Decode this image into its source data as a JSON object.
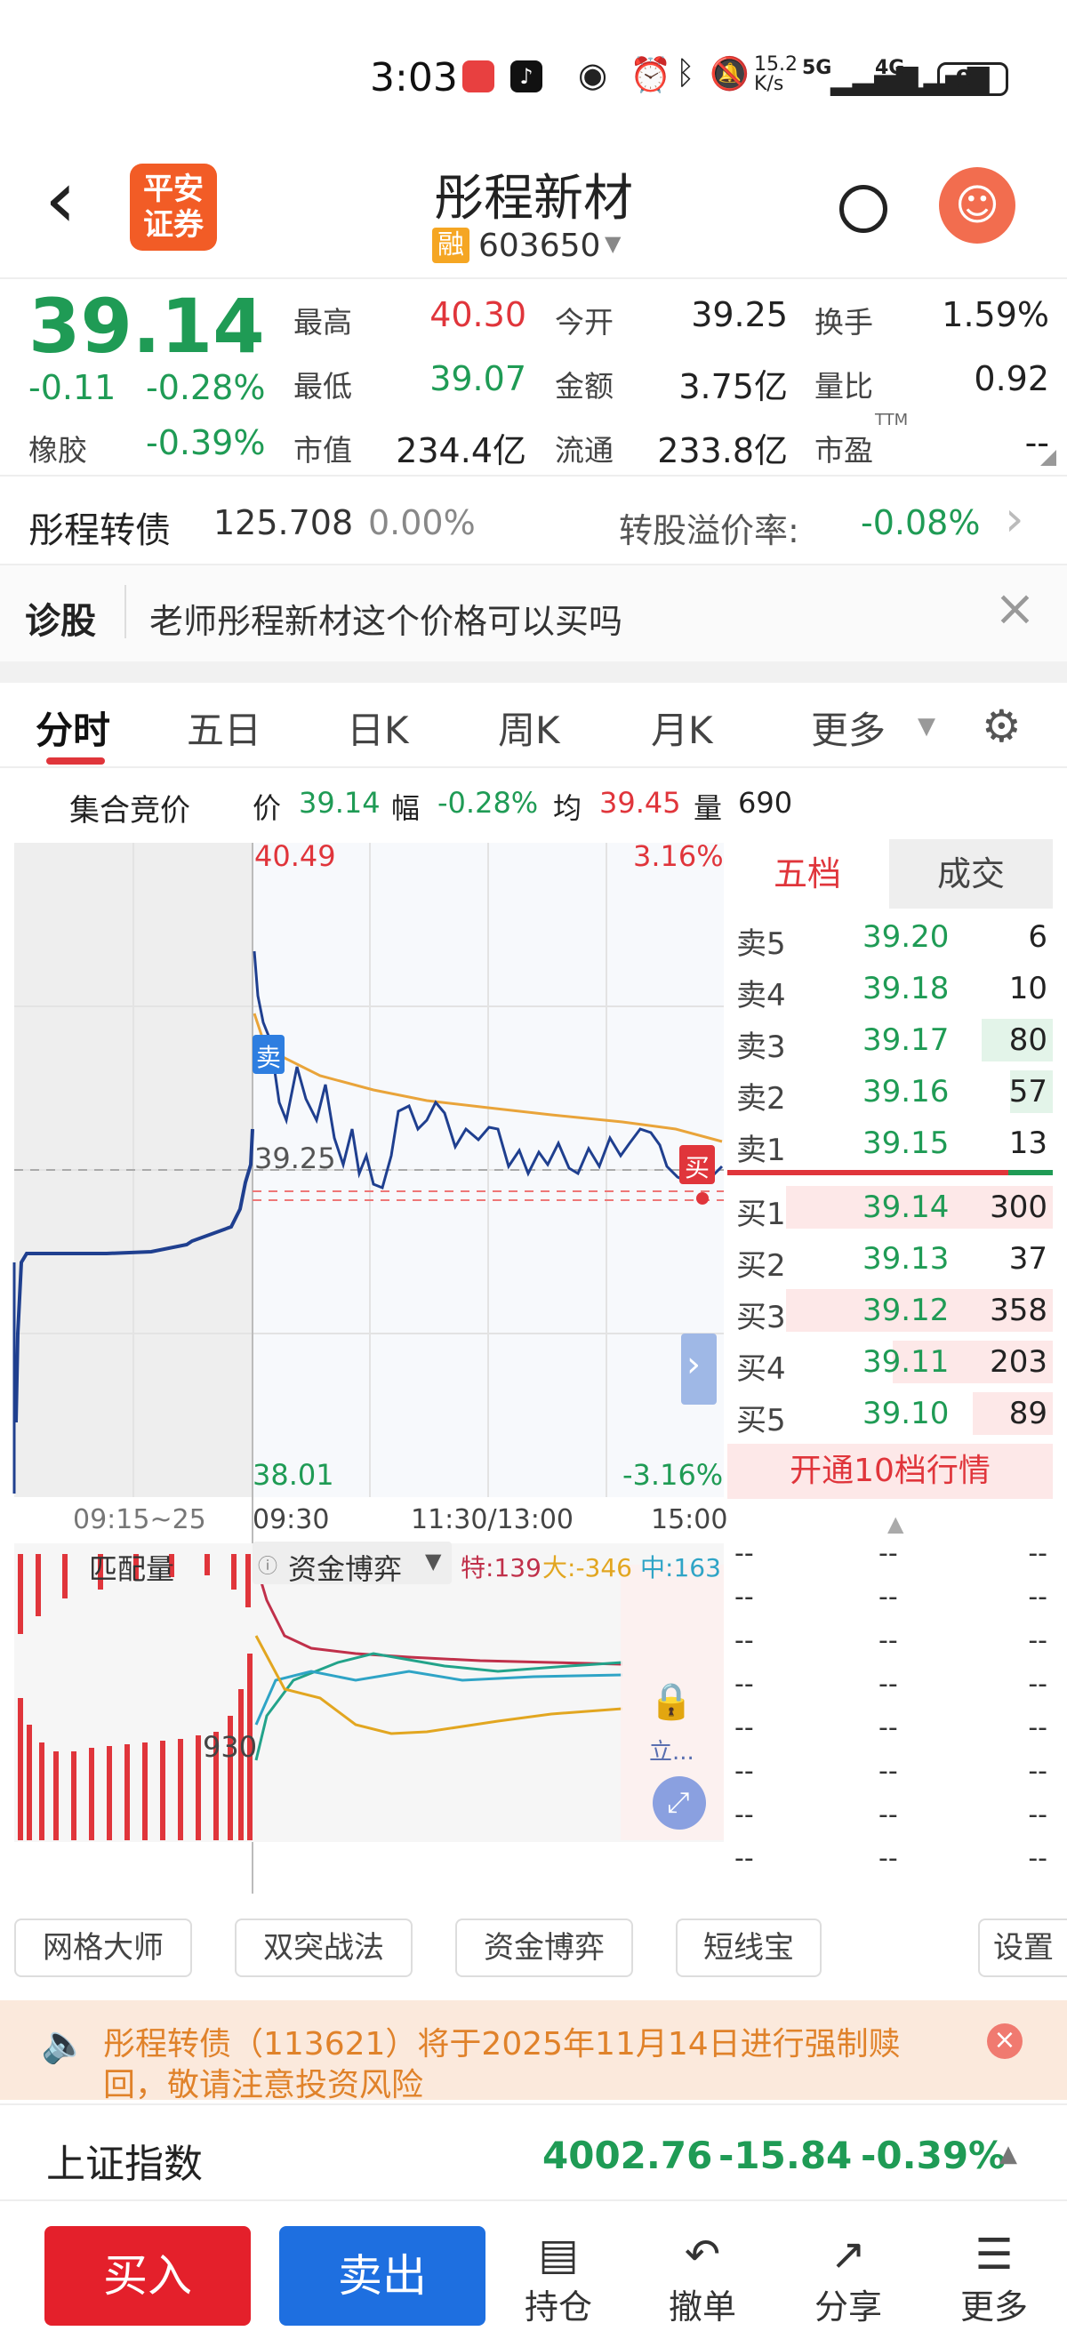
{
  "status": {
    "time": "3:03",
    "net_speed_top": "15.2",
    "net_speed_bottom": "K/s",
    "sig1": "5G",
    "sig2": "4G",
    "battery": "91"
  },
  "header": {
    "back": "‹",
    "broker_logo_line1": "平安",
    "broker_logo_line2": "证券",
    "title": "彤程新材",
    "margin_badge": "融",
    "code": "603650"
  },
  "quote": {
    "price": "39.14",
    "change": "-0.11",
    "change_pct": "-0.28%",
    "sector_label": "橡胶",
    "sector_pct": "-0.39%",
    "high_label": "最高",
    "high": "40.30",
    "low_label": "最低",
    "low": "39.07",
    "mcap_label": "市值",
    "mcap": "234.4亿",
    "open_label": "今开",
    "open": "39.25",
    "amount_label": "金额",
    "amount": "3.75亿",
    "float_label": "流通",
    "float": "233.8亿",
    "turnover_label": "换手",
    "turnover": "1.59%",
    "volratio_label": "量比",
    "volratio": "0.92",
    "pe_label": "市盈",
    "pe_sup": "TTM",
    "pe": "--"
  },
  "convertible": {
    "name": "彤程转债",
    "price": "125.708",
    "pct": "0.00%",
    "premium_label": "转股溢价率:",
    "premium": "-0.08%"
  },
  "diagnose": {
    "label": "诊股",
    "text": "老师彤程新材这个价格可以买吗"
  },
  "tabs": [
    "分时",
    "五日",
    "日K",
    "周K",
    "月K",
    "更多"
  ],
  "chart_info": {
    "auction": "集合竞价",
    "price_label": "价",
    "price": "39.14",
    "amp_label": "幅",
    "amp": "-0.28%",
    "avg_label": "均",
    "avg": "39.45",
    "vol_label": "量",
    "vol": "690"
  },
  "chart_labels": {
    "top_left": "40.49",
    "top_right": "3.16%",
    "bottom_left": "38.01",
    "bottom_right": "-3.16%",
    "mid": "39.25",
    "sell_tag": "卖",
    "buy_tag": "买"
  },
  "time_axis": [
    "09:15~25",
    "09:30",
    "11:30/13:00",
    "15:00"
  ],
  "sub_chart": {
    "tab1": "匹配量",
    "tab2": "资金博弈",
    "te_label": "特:",
    "te": "139",
    "da_label": "大:",
    "da": "-346",
    "zhong_label": "中:",
    "zhong": "163",
    "val": "930",
    "lock_text": "立..."
  },
  "book": {
    "tab_five": "五档",
    "tab_deal": "成交",
    "asks": [
      {
        "l": "卖5",
        "p": "39.20",
        "v": "6"
      },
      {
        "l": "卖4",
        "p": "39.18",
        "v": "10"
      },
      {
        "l": "卖3",
        "p": "39.17",
        "v": "80"
      },
      {
        "l": "卖2",
        "p": "39.16",
        "v": "57"
      },
      {
        "l": "卖1",
        "p": "39.15",
        "v": "13"
      }
    ],
    "bids": [
      {
        "l": "买1",
        "p": "39.14",
        "v": "300"
      },
      {
        "l": "买2",
        "p": "39.13",
        "v": "37"
      },
      {
        "l": "买3",
        "p": "39.12",
        "v": "358"
      },
      {
        "l": "买4",
        "p": "39.11",
        "v": "203"
      },
      {
        "l": "买5",
        "p": "39.10",
        "v": "89"
      }
    ],
    "open10": "开通10档行情",
    "dash": "--"
  },
  "tools": [
    "网格大师",
    "双突战法",
    "资金博弈",
    "短线宝",
    "设置"
  ],
  "notice": {
    "text1": "彤程转债（113621）将于2025年11月14日进行强制赎",
    "text2": "回，敬请注意投资风险"
  },
  "index": {
    "name": "上证指数",
    "value": "4002.76",
    "change": "-15.84",
    "pct": "-0.39%"
  },
  "bottom": {
    "buy": "买入",
    "sell": "卖出",
    "hold": "持仓",
    "cancel": "撤单",
    "share": "分享",
    "more": "更多"
  },
  "colors": {
    "up": "#e0353b",
    "down": "#1f9b55",
    "buy_btn": "#e4202b",
    "sell_btn": "#1e6fe0",
    "price_line": "#1f3f8f",
    "avg_line": "#e9a43a"
  }
}
